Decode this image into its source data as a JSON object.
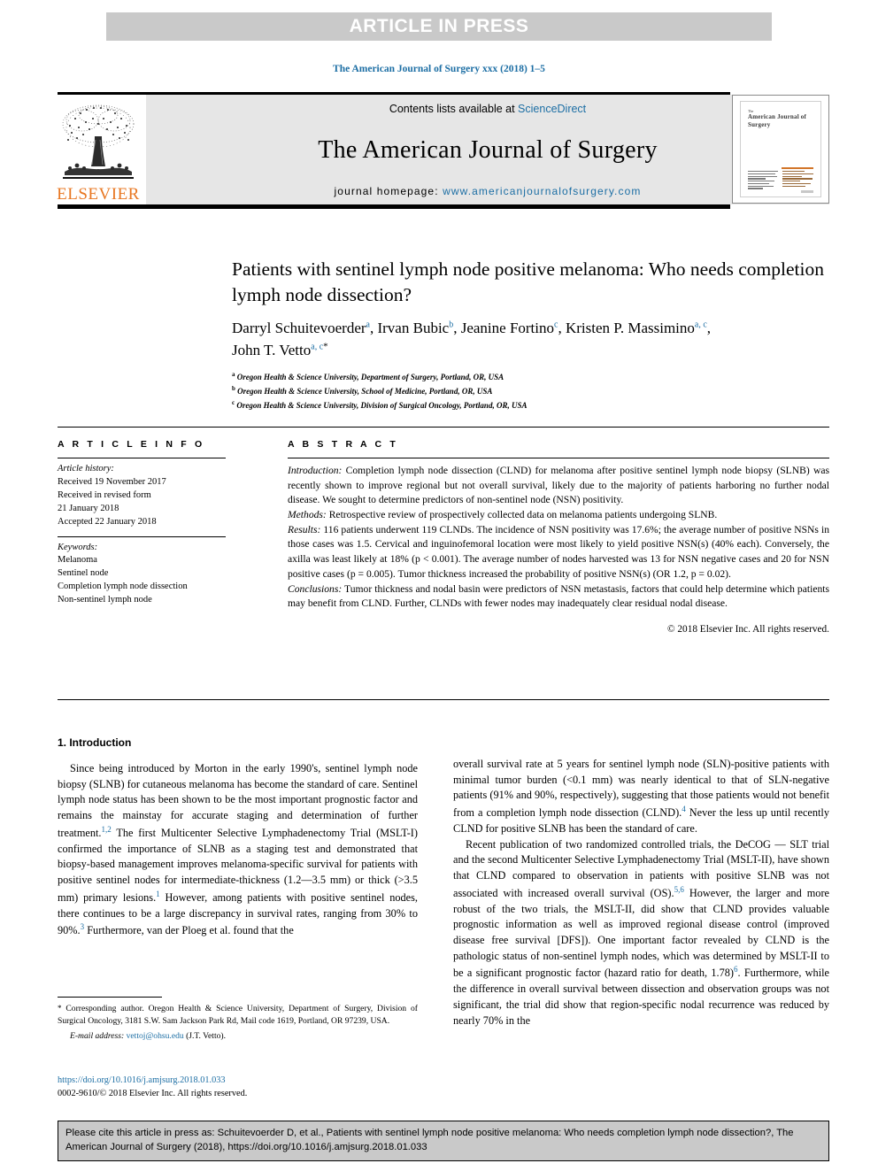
{
  "banner": {
    "label": "ARTICLE IN PRESS"
  },
  "running_head": {
    "text": "The American Journal of Surgery xxx (2018) 1–5"
  },
  "masthead": {
    "contents_prefix": "Contents lists available at ",
    "contents_link": "ScienceDirect",
    "journal_name": "The American Journal of Surgery",
    "homepage_prefix": "journal homepage: ",
    "homepage_url": "www.americanjournalofsurgery.com",
    "publisher_logo_text": "ELSEVIER",
    "cover_title_small": "The",
    "cover_title_main": "American Journal of Surgery"
  },
  "article": {
    "title": "Patients with sentinel lymph node positive melanoma: Who needs completion lymph node dissection?",
    "authors": [
      {
        "name": "Darryl Schuitevoerder",
        "marks": "a",
        "star": false
      },
      {
        "name": "Irvan Bubic",
        "marks": "b",
        "star": false
      },
      {
        "name": "Jeanine Fortino",
        "marks": "c",
        "star": false
      },
      {
        "name": "Kristen P. Massimino",
        "marks": "a, c",
        "star": false
      },
      {
        "name": "John T. Vetto",
        "marks": "a, c",
        "star": true
      }
    ],
    "affiliations": [
      {
        "mark": "a",
        "text": "Oregon Health & Science University, Department of Surgery, Portland, OR, USA"
      },
      {
        "mark": "b",
        "text": "Oregon Health & Science University, School of Medicine, Portland, OR, USA"
      },
      {
        "mark": "c",
        "text": "Oregon Health & Science University, Division of Surgical Oncology, Portland, OR, USA"
      }
    ]
  },
  "article_info": {
    "heading": "A R T I C L E  I N F O",
    "history_label": "Article history:",
    "history_lines": [
      "Received 19 November 2017",
      "Received in revised form",
      "21 January 2018",
      "Accepted 22 January 2018"
    ],
    "keywords_label": "Keywords:",
    "keywords": [
      "Melanoma",
      "Sentinel node",
      "Completion lymph node dissection",
      "Non-sentinel lymph node"
    ]
  },
  "abstract": {
    "heading": "A B S T R A C T",
    "sections": [
      {
        "label": "Introduction:",
        "text": " Completion lymph node dissection (CLND) for melanoma after positive sentinel lymph node biopsy (SLNB) was recently shown to improve regional but not overall survival, likely due to the majority of patients harboring no further nodal disease. We sought to determine predictors of non-sentinel node (NSN) positivity."
      },
      {
        "label": "Methods:",
        "text": " Retrospective review of prospectively collected data on melanoma patients undergoing SLNB."
      },
      {
        "label": "Results:",
        "text": " 116 patients underwent 119 CLNDs. The incidence of NSN positivity was 17.6%; the average number of positive NSNs in those cases was 1.5. Cervical and inguinofemoral location were most likely to yield positive NSN(s) (40% each). Conversely, the axilla was least likely at 18% (p < 0.001). The average number of nodes harvested was 13 for NSN negative cases and 20 for NSN positive cases (p = 0.005). Tumor thickness increased the probability of positive NSN(s) (OR 1.2, p = 0.02)."
      },
      {
        "label": "Conclusions:",
        "text": " Tumor thickness and nodal basin were predictors of NSN metastasis, factors that could help determine which patients may benefit from CLND. Further, CLNDs with fewer nodes may inadequately clear residual nodal disease."
      }
    ],
    "copyright": "© 2018 Elsevier Inc. All rights reserved."
  },
  "body": {
    "section_heading": "1. Introduction",
    "left_paragraphs": [
      "Since being introduced by Morton in the early 1990's, sentinel lymph node biopsy (SLNB) for cutaneous melanoma has become the standard of care. Sentinel lymph node status has been shown to be the most important prognostic factor and remains the mainstay for accurate staging and determination of further treatment.",
      "The first Multicenter Selective Lymphadenectomy Trial (MSLT-I) confirmed the importance of SLNB as a staging test and demonstrated that biopsy-based management improves melanoma-specific survival for patients with positive sentinel nodes for intermediate-thickness (1.2—3.5 mm) or thick (>3.5 mm) primary lesions.",
      "However, among patients with positive sentinel nodes, there continues to be a large discrepancy in survival rates, ranging from 30% to 90%.",
      "Furthermore, van der Ploeg et al. found that the"
    ],
    "left_refs": {
      "r1": "1,2",
      "r2": "1",
      "r3": "3"
    },
    "right_paragraphs": [
      "overall survival rate at 5 years for sentinel lymph node (SLN)-positive patients with minimal tumor burden (<0.1 mm) was nearly identical to that of SLN-negative patients (91% and 90%, respectively), suggesting that those patients would not benefit from a completion lymph node dissection (CLND).",
      "Never the less up until recently CLND for positive SLNB has been the standard of care.",
      "Recent publication of two randomized controlled trials, the DeCOG — SLT trial and the second Multicenter Selective Lymphadenectomy Trial (MSLT-II), have shown that CLND compared to observation in patients with positive SLNB was not associated with increased overall survival (OS).",
      "However, the larger and more robust of the two trials, the MSLT-II, did show that CLND provides valuable prognostic information as well as improved regional disease control (improved disease free survival [DFS]). One important factor revealed by CLND is the pathologic status of non-sentinel lymph nodes, which was determined by MSLT-II to be a significant prognostic factor (hazard ratio for death, 1.78)",
      ". Furthermore, while the difference in overall survival between dissection and observation groups was not significant, the trial did show that region-specific nodal recurrence was reduced by nearly 70% in the"
    ],
    "right_refs": {
      "r4": "4",
      "r56": "5,6",
      "r6": "6"
    }
  },
  "footnote": {
    "star": "*",
    "text": " Corresponding author. Oregon Health & Science University, Department of Surgery, Division of Surgical Oncology, 3181 S.W. Sam Jackson Park Rd, Mail code 1619, Portland, OR 97239, USA.",
    "email_label": "E-mail address:",
    "email": "vettoj@ohsu.edu",
    "email_attrib": "(J.T. Vetto)."
  },
  "doi_block": {
    "doi": "https://doi.org/10.1016/j.amjsurg.2018.01.033",
    "issn_copyright": "0002-9610/© 2018 Elsevier Inc. All rights reserved."
  },
  "cite_box": {
    "text": "Please cite this article in press as: Schuitevoerder D, et al., Patients with sentinel lymph node positive melanoma: Who needs completion lymph node dissection?, The American Journal of Surgery (2018), https://doi.org/10.1016/j.amjsurg.2018.01.033"
  },
  "colors": {
    "link": "#1c6ea4",
    "elsevier_orange": "#e87722",
    "banner_grey": "#c9c9c9",
    "masthead_grey": "#e6e6e6"
  }
}
